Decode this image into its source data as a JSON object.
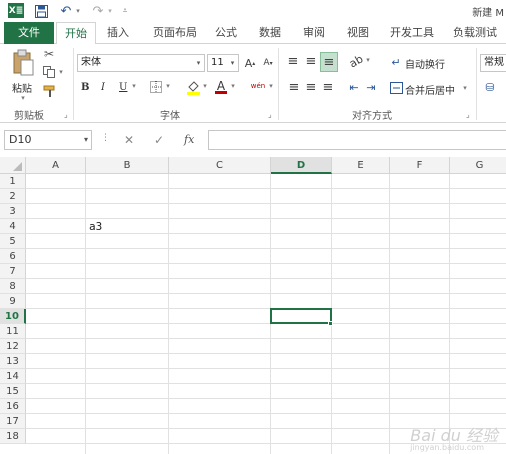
{
  "window": {
    "title": "新建 M",
    "app_logo": "X≣"
  },
  "ribbon_tabs": [
    "文件",
    "开始",
    "插入",
    "页面布局",
    "公式",
    "数据",
    "审阅",
    "视图",
    "开发工具",
    "负载测试"
  ],
  "active_tab": "开始",
  "clipboard": {
    "paste_label": "粘贴",
    "group_label": "剪贴板"
  },
  "font": {
    "name": "宋体",
    "size": "11",
    "bold": "B",
    "italic": "I",
    "underline": "U",
    "group_label": "字体",
    "phonetic": "wén"
  },
  "alignment": {
    "wrap_text": "自动换行",
    "merge_center": "合并后居中",
    "group_label": "对齐方式"
  },
  "number": {
    "format": "常规"
  },
  "formula_bar": {
    "name_box": "D10",
    "fx": "fx",
    "value": ""
  },
  "columns": [
    "A",
    "B",
    "C",
    "D",
    "E",
    "F",
    "G"
  ],
  "selected_column": "D",
  "rows": [
    "1",
    "2",
    "3",
    "4",
    "5",
    "6",
    "7",
    "8",
    "9",
    "10",
    "11",
    "12",
    "13",
    "14",
    "15",
    "16",
    "17",
    "18"
  ],
  "selected_row": "10",
  "cells": {
    "B4": "a3"
  },
  "watermark": {
    "text": "Bai du 经验",
    "sub": "jingyan.baidu.com"
  },
  "colors": {
    "accent": "#217346",
    "gridline": "#e1e1e1",
    "header_bg": "#f3f3f3"
  }
}
